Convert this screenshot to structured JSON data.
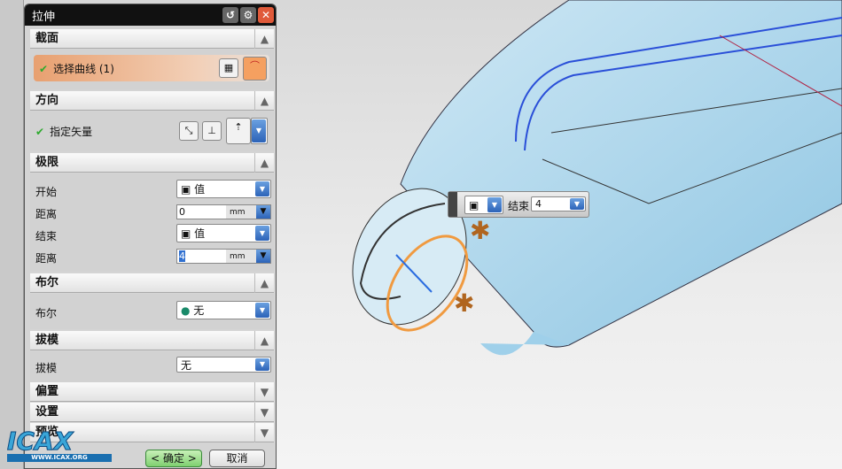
{
  "dialog": {
    "title": "拉伸"
  },
  "sections": {
    "section": {
      "title": "截面",
      "select_curve": "选择曲线 (1)"
    },
    "direction": {
      "title": "方向",
      "specify_vector": "指定矢量"
    },
    "limits": {
      "title": "极限",
      "start_label": "开始",
      "start_value": "值",
      "distance1_label": "距离",
      "distance1_value": "0",
      "unit1": "mm",
      "end_label": "结束",
      "end_value": "值",
      "distance2_label": "距离",
      "distance2_value": "4",
      "unit2": "mm"
    },
    "boolean": {
      "title": "布尔",
      "label": "布尔",
      "value": "无"
    },
    "draft": {
      "title": "拔模",
      "label": "拔模",
      "value": "无"
    },
    "offset": {
      "title": "偏置"
    },
    "settings": {
      "title": "设置"
    },
    "preview": {
      "title": "预览"
    }
  },
  "buttons": {
    "ok": "< 确定 >",
    "cancel": "取消"
  },
  "floating": {
    "end_label": "结束",
    "end_value": "4"
  },
  "watermark": {
    "logo": "ICAX",
    "url": "WWW.ICAX.ORG"
  }
}
